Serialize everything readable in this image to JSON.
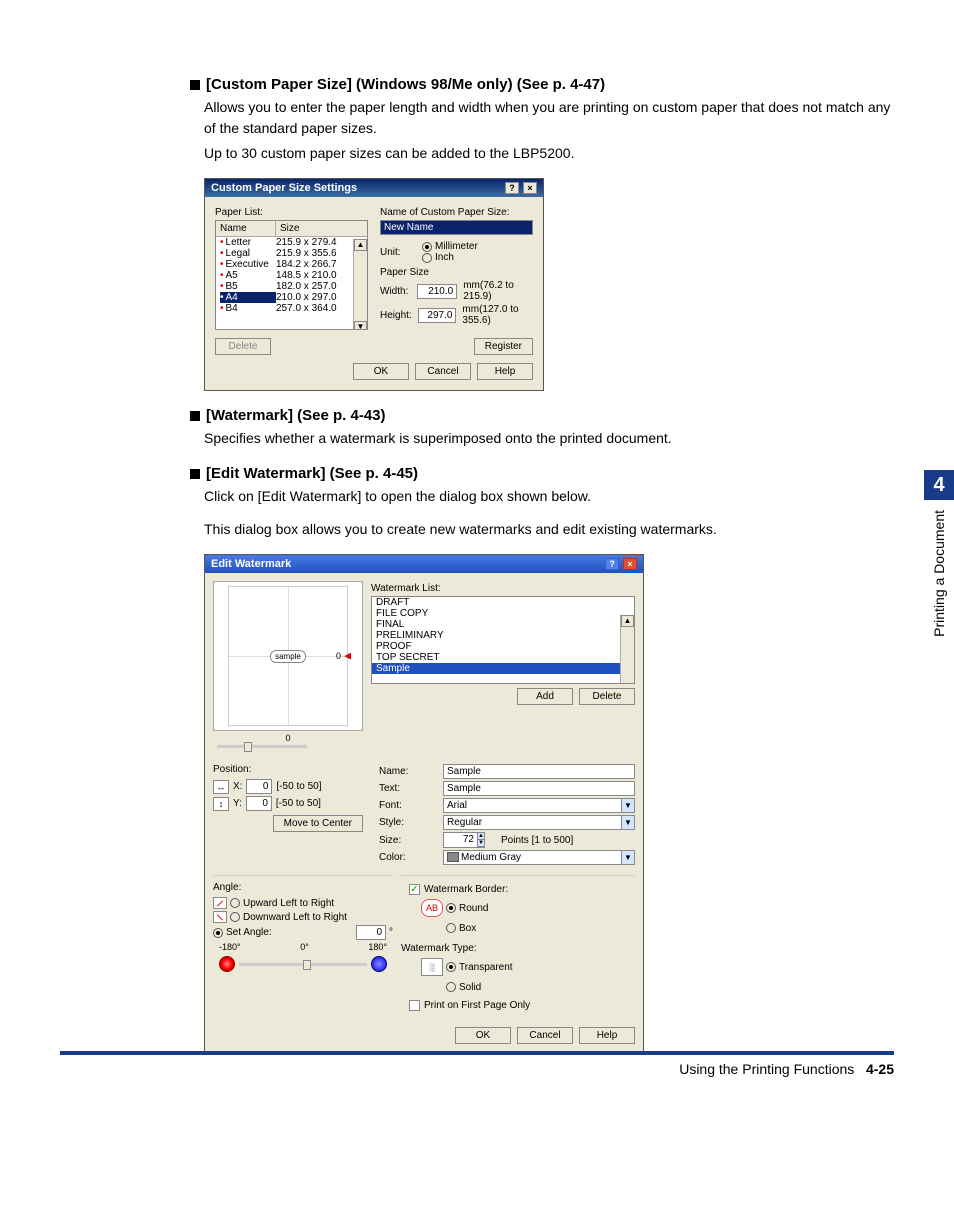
{
  "sideTab": "4",
  "sideText": "Printing a Document",
  "sec1": {
    "title": "[Custom Paper Size] (Windows 98/Me only) (See p. 4-47)",
    "p1": "Allows you to enter the paper length and width when you are printing on custom paper that does not match any of the standard paper sizes.",
    "p2": "Up to 30 custom paper sizes can be added to the LBP5200."
  },
  "dlg1": {
    "title": "Custom Paper Size Settings",
    "paperListLabel": "Paper List:",
    "cols": {
      "name": "Name",
      "size": "Size"
    },
    "rows": [
      {
        "n": "Letter",
        "s": "215.9 x 279.4"
      },
      {
        "n": "Legal",
        "s": "215.9 x 355.6"
      },
      {
        "n": "Executive",
        "s": "184.2 x 266.7"
      },
      {
        "n": "A5",
        "s": "148.5 x 210.0"
      },
      {
        "n": "B5",
        "s": "182.0 x 257.0"
      },
      {
        "n": "A4",
        "s": "210.0 x 297.0"
      },
      {
        "n": "B4",
        "s": "257.0 x 364.0"
      }
    ],
    "nameLabel": "Name of Custom Paper Size:",
    "nameVal": "New Name",
    "unitLabel": "Unit:",
    "unitMM": "Millimeter",
    "unitIn": "Inch",
    "psLabel": "Paper Size",
    "widthL": "Width:",
    "widthV": "210.0",
    "widthH": "mm(76.2 to 215.9)",
    "heightL": "Height:",
    "heightV": "297.0",
    "heightH": "mm(127.0 to 355.6)",
    "delete": "Delete",
    "register": "Register",
    "ok": "OK",
    "cancel": "Cancel",
    "help": "Help"
  },
  "sec2": {
    "title": "[Watermark] (See p. 4-43)",
    "p": "Specifies whether a watermark is superimposed onto the printed document."
  },
  "sec3": {
    "title": "[Edit Watermark] (See p. 4-45)",
    "p1": "Click on [Edit Watermark] to open the dialog box shown below.",
    "p2": "This dialog box allows you to create new watermarks and edit existing watermarks."
  },
  "dlg2": {
    "title": "Edit Watermark",
    "wmListL": "Watermark List:",
    "items": [
      "DRAFT",
      "FILE COPY",
      "FINAL",
      "PRELIMINARY",
      "PROOF",
      "TOP SECRET",
      "Sample"
    ],
    "add": "Add",
    "delete": "Delete",
    "nameL": "Name:",
    "nameV": "Sample",
    "textL": "Text:",
    "textV": "Sample",
    "fontL": "Font:",
    "fontV": "Arial",
    "styleL": "Style:",
    "styleV": "Regular",
    "sizeL": "Size:",
    "sizeV": "72",
    "sizeH": "Points [1 to 500]",
    "colorL": "Color:",
    "colorV": "Medium Gray",
    "posL": "Position:",
    "xL": "X:",
    "xV": "0",
    "xR": "[-50 to 50]",
    "yL": "Y:",
    "yV": "0",
    "yR": "[-50 to 50]",
    "move": "Move to Center",
    "angleL": "Angle:",
    "aUp": "Upward Left to Right",
    "aDn": "Downward Left to Right",
    "aSet": "Set Angle:",
    "aVal": "0",
    "aDeg": "°",
    "aScale": {
      "l": "-180°",
      "m": "0°",
      "r": "180°"
    },
    "wbL": "Watermark Border:",
    "wbRound": "Round",
    "wbBox": "Box",
    "wtL": "Watermark Type:",
    "wtTrans": "Transparent",
    "wtSolid": "Solid",
    "pfp": "Print on First Page Only",
    "ok": "OK",
    "cancel": "Cancel",
    "help": "Help",
    "zoomVal": "0",
    "zoomPage": "0",
    "prevText": "sample"
  },
  "footer": {
    "using": "Using the Printing Functions",
    "page": "4-25"
  }
}
